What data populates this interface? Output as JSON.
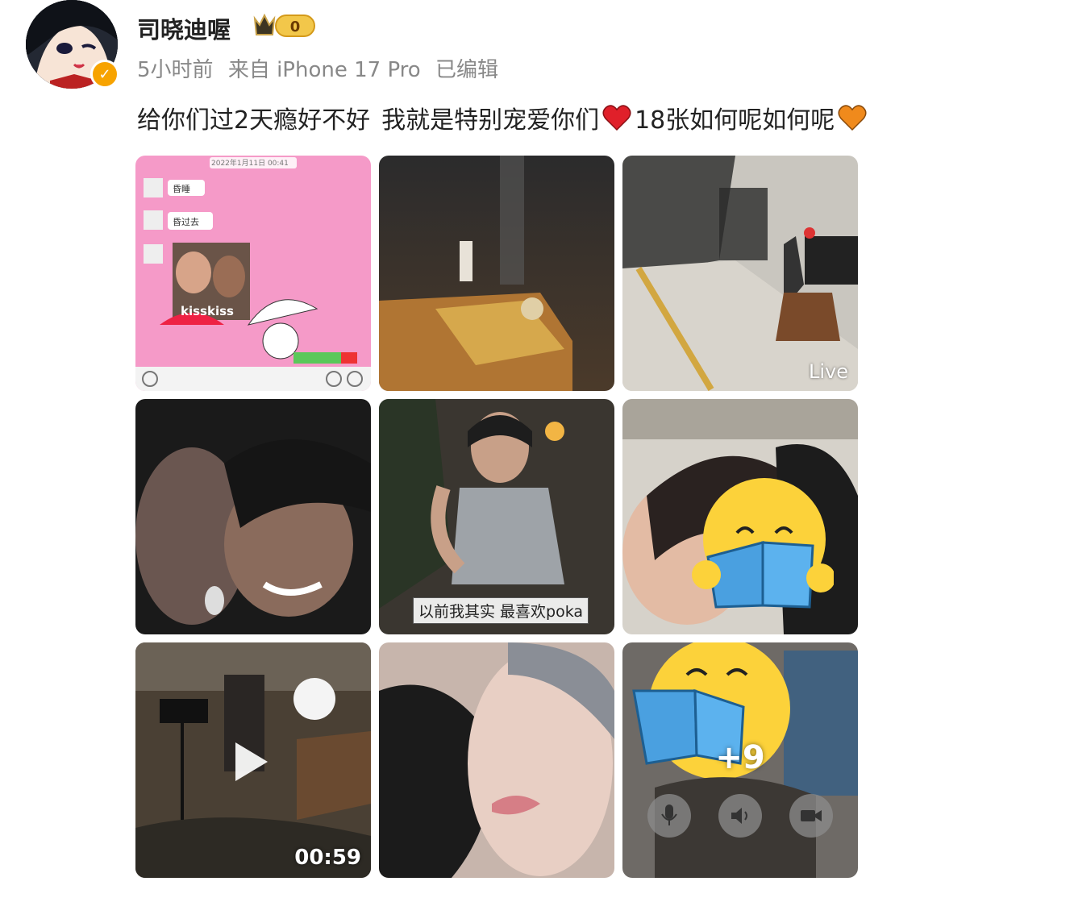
{
  "post": {
    "username": "司晓迪喔",
    "level_badge": "0",
    "time": "5小时前",
    "source": "来自 iPhone 17 Pro",
    "edited": "已编辑",
    "text_part1": "给你们过2天瘾好不好",
    "text_part2": "我就是特别宠爱你们",
    "text_part3": "18张如何呢如何呢",
    "colors": {
      "heart_red": "#e0202a",
      "heart_orange": "#f08a1c",
      "verified": "#f7a300"
    }
  },
  "grid": {
    "tiles": [
      {
        "kind": "chat-screenshot",
        "chat": {
          "header": "2022年1月11日 00:41",
          "msg1": "昏睡",
          "msg2": "昏过去",
          "sticker_text": "kisskiss"
        }
      },
      {
        "kind": "photo"
      },
      {
        "kind": "photo",
        "live_label": "Live"
      },
      {
        "kind": "photo"
      },
      {
        "kind": "photo",
        "caption": "以前我其实 最喜欢poka"
      },
      {
        "kind": "photo",
        "icon": "reading-emoji-icon"
      },
      {
        "kind": "video",
        "duration": "00:59",
        "icon": "play-icon"
      },
      {
        "kind": "photo"
      },
      {
        "kind": "more",
        "more_count": "+9",
        "icons": [
          "microphone-icon",
          "speaker-icon",
          "camera-icon"
        ]
      }
    ]
  }
}
